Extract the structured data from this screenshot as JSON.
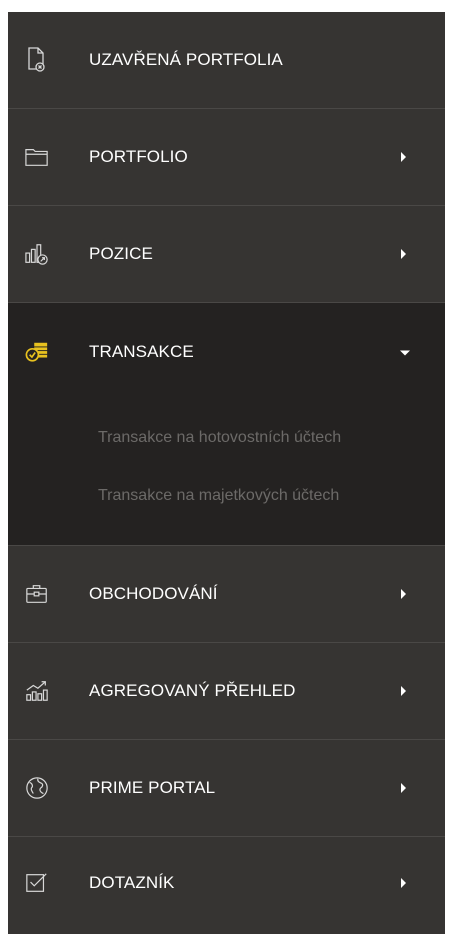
{
  "menu": {
    "items": [
      {
        "label": "UZAVŘENÁ PORTFOLIA",
        "icon": "closed-document-icon",
        "has_arrow": false
      },
      {
        "label": "PORTFOLIO",
        "icon": "folder-icon",
        "has_arrow": true
      },
      {
        "label": "POZICE",
        "icon": "position-chart-icon",
        "has_arrow": true
      },
      {
        "label": "TRANSAKCE",
        "icon": "transactions-icon",
        "has_arrow": true,
        "expanded": true,
        "subitems": [
          "Transakce na hotovostních účtech",
          "Transakce na majetkových účtech"
        ]
      },
      {
        "label": "OBCHODOVÁNÍ",
        "icon": "briefcase-icon",
        "has_arrow": true
      },
      {
        "label": "AGREGOVANÝ PŘEHLED",
        "icon": "growth-chart-icon",
        "has_arrow": true
      },
      {
        "label": "PRIME PORTAL",
        "icon": "globe-icon",
        "has_arrow": true
      },
      {
        "label": "DOTAZNÍK",
        "icon": "checkbox-icon",
        "has_arrow": true
      }
    ]
  },
  "colors": {
    "background": "#363432",
    "expanded_background": "#242221",
    "text": "#ffffff",
    "subitem_text": "#6c6a68",
    "accent_icon": "#e8c21f",
    "icon_outline": "#d8d8d8"
  }
}
